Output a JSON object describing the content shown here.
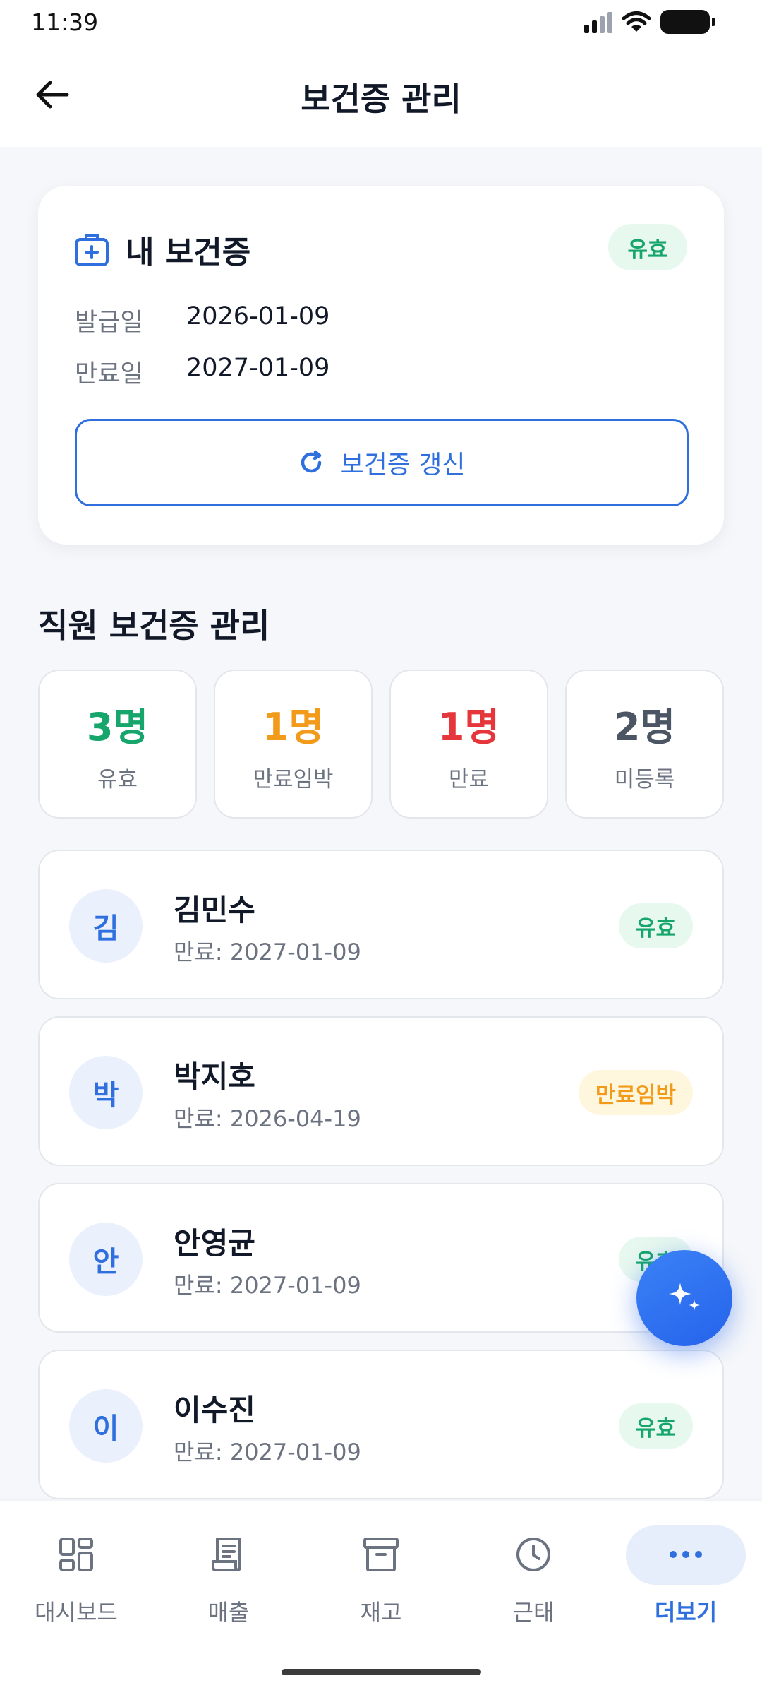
{
  "status_bar": {
    "time": "11:39"
  },
  "header": {
    "title": "보건증 관리"
  },
  "my_card": {
    "title": "내 보건증",
    "status": "유효",
    "rows": [
      {
        "label": "발급일",
        "value": "2026-01-09"
      },
      {
        "label": "만료일",
        "value": "2027-01-09"
      }
    ],
    "renew_label": "보건증 갱신"
  },
  "staff_section": {
    "title": "직원 보건증 관리",
    "stats": [
      {
        "value": "3명",
        "label": "유효",
        "color": "#16a56b"
      },
      {
        "value": "1명",
        "label": "만료임박",
        "color": "#f29a1a"
      },
      {
        "value": "1명",
        "label": "만료",
        "color": "#e5363b"
      },
      {
        "value": "2명",
        "label": "미등록",
        "color": "#4b5563"
      }
    ],
    "list": [
      {
        "initial": "김",
        "name": "김민수",
        "expire": "만료: 2027-01-09",
        "status": "유효"
      },
      {
        "initial": "박",
        "name": "박지호",
        "expire": "만료: 2026-04-19",
        "status": "만료임박"
      },
      {
        "initial": "안",
        "name": "안영균",
        "expire": "만료: 2027-01-09",
        "status": "유효"
      },
      {
        "initial": "이",
        "name": "이수진",
        "expire": "만료: 2027-01-09",
        "status": "유효"
      }
    ]
  },
  "bottom_nav": {
    "items": [
      {
        "label": "대시보드",
        "icon": "dashboard-icon"
      },
      {
        "label": "매출",
        "icon": "receipt-icon"
      },
      {
        "label": "재고",
        "icon": "inventory-box-icon"
      },
      {
        "label": "근태",
        "icon": "clock-icon"
      },
      {
        "label": "더보기",
        "icon": "more-dots-icon",
        "active": true
      }
    ]
  },
  "colors": {
    "accent": "#2f6fde",
    "valid": "#16a56b",
    "soon": "#f29a1a",
    "expired": "#e5363b"
  }
}
